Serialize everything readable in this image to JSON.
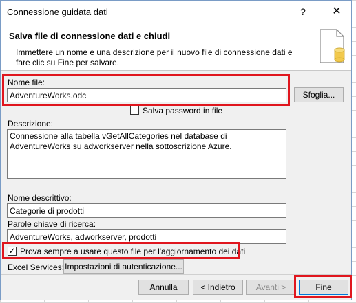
{
  "window": {
    "title": "Connessione guidata dati",
    "help_label": "?",
    "close_label": "✕"
  },
  "header": {
    "title": "Salva file di connessione dati e chiudi",
    "description": "Immettere un nome e una descrizione per il nuovo file di connessione dati e fare clic su Fine per salvare."
  },
  "form": {
    "file_name_label": "Nome file:",
    "file_name_value": "AdventureWorks.odc",
    "browse_label": "Sfoglia...",
    "save_password_label": "Salva password in file",
    "save_password_checked": false,
    "description_label": "Descrizione:",
    "description_value": "Connessione alla tabella vGetAllCategories nel database di AdventureWorks su adworkserver nella sottoscrizione Azure.",
    "friendly_name_label": "Nome descrittivo:",
    "friendly_name_value": "Categorie di prodotti",
    "keywords_label": "Parole chiave di ricerca:",
    "keywords_value": "AdventureWorks, adworkserver, prodotti",
    "always_use_label": "Prova sempre a usare questo file per l'aggiornamento dei dati",
    "always_use_checked": true,
    "excel_services_label": "Excel Services:",
    "auth_settings_label": "Impostazioni di autenticazione..."
  },
  "footer": {
    "cancel_label": "Annulla",
    "back_label": "< Indietro",
    "next_label": "Avanti >",
    "finish_label": "Fine"
  },
  "colors": {
    "highlight": "#e0161e",
    "accent": "#0078d7",
    "icon_cylinder": "#f2c94c"
  }
}
